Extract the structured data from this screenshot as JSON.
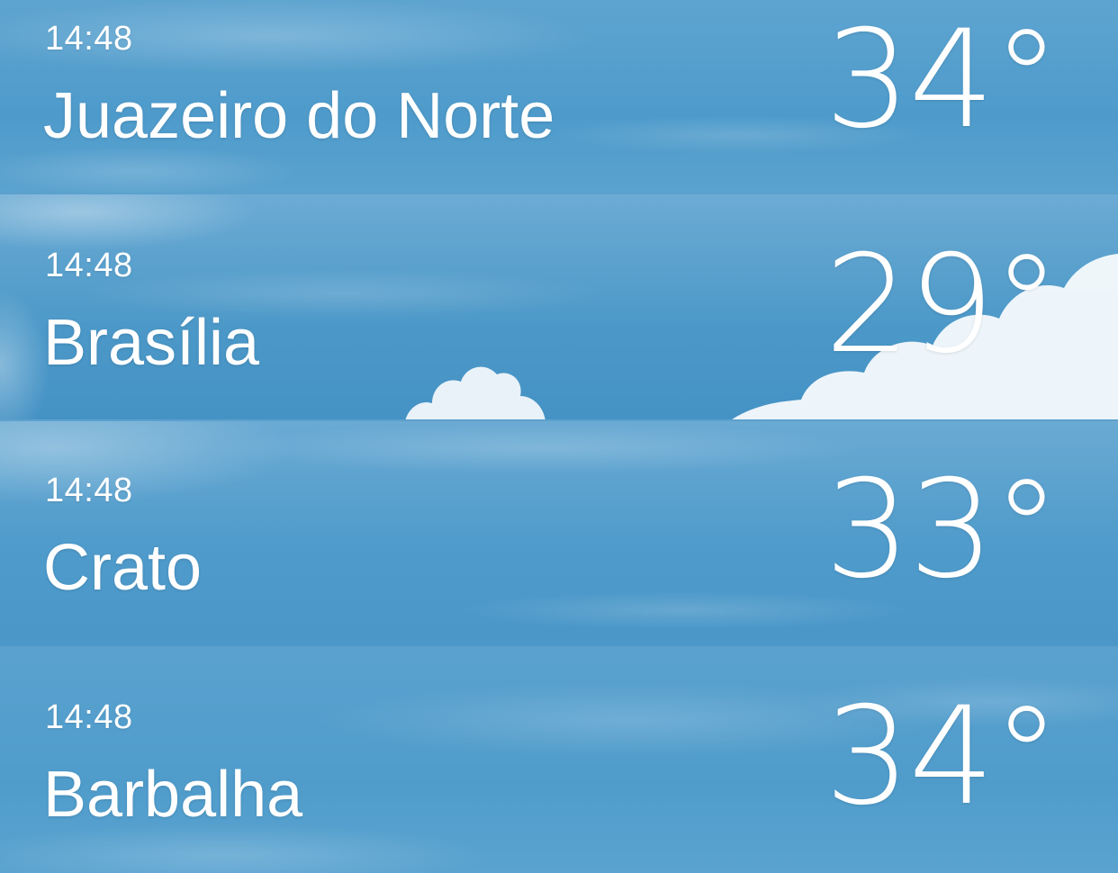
{
  "locations": [
    {
      "time": "14:48",
      "city": "Juazeiro do Norte",
      "temperature": "34°"
    },
    {
      "time": "14:48",
      "city": "Brasília",
      "temperature": "29°"
    },
    {
      "time": "14:48",
      "city": "Crato",
      "temperature": "33°"
    },
    {
      "time": "14:48",
      "city": "Barbalha",
      "temperature": "34°"
    }
  ],
  "colors": {
    "sky_blue": "#4a97c8",
    "text": "#ffffff"
  }
}
